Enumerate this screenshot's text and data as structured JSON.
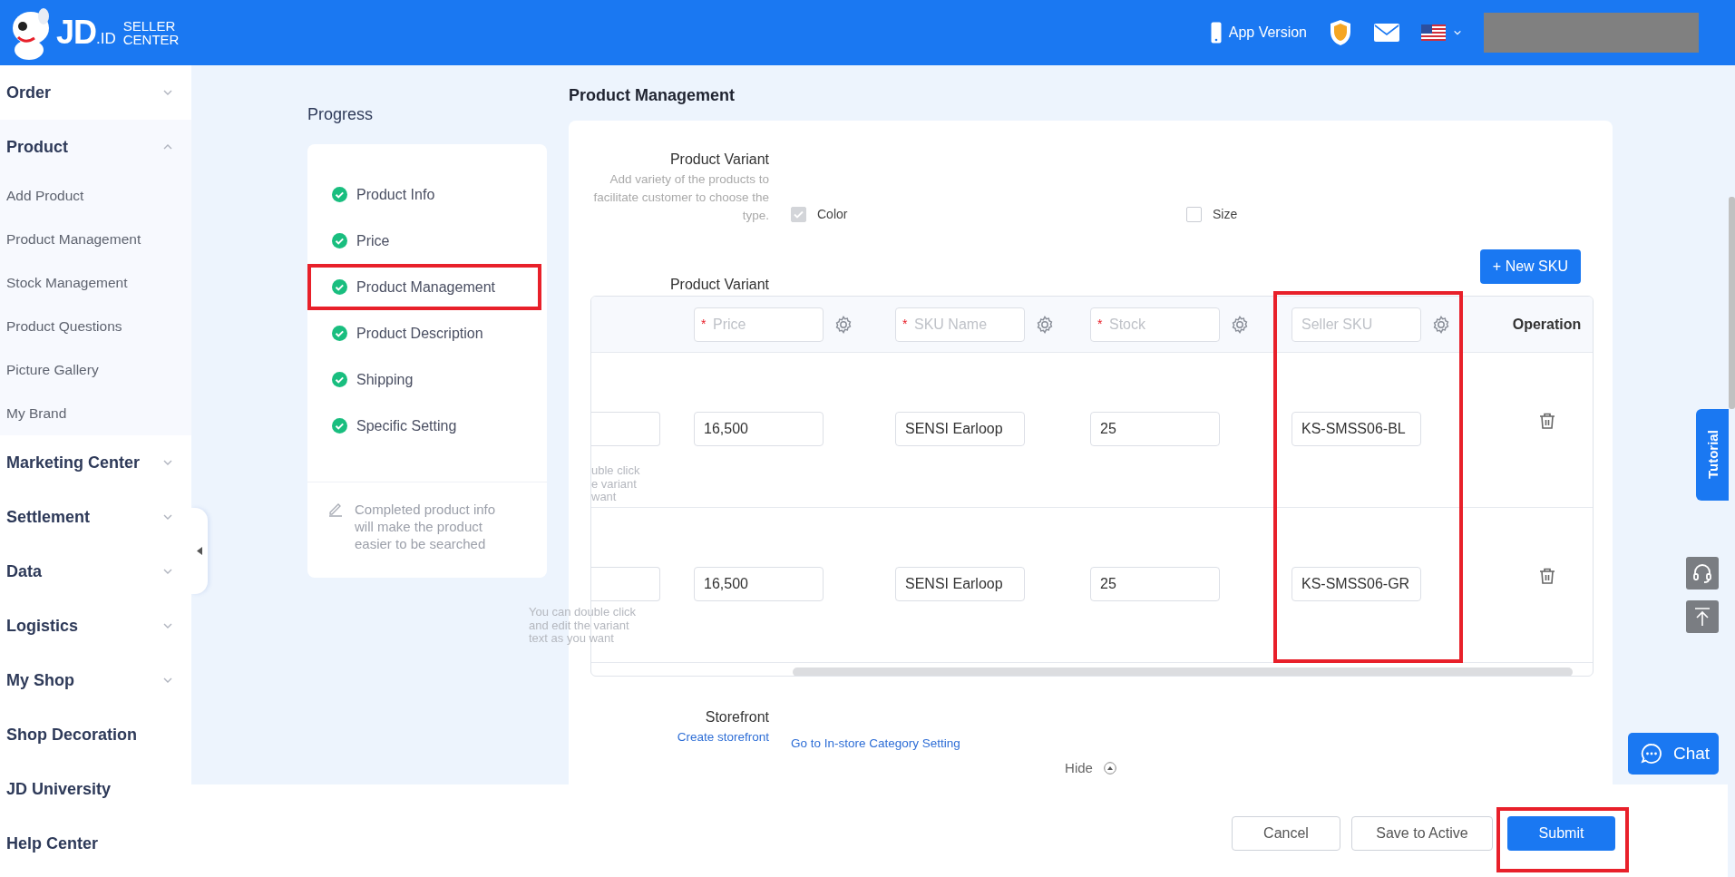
{
  "header": {
    "wordmark": "JD",
    "wordmark_suffix": ".ID",
    "subtitle": "SELLER CENTER",
    "app_version": "App Version"
  },
  "sidebar": {
    "items": [
      {
        "label": "Order",
        "kind": "group",
        "expanded": false
      },
      {
        "label": "Product",
        "kind": "group",
        "expanded": true,
        "children": [
          {
            "label": "Add Product"
          },
          {
            "label": "Product Management"
          },
          {
            "label": "Stock Management"
          },
          {
            "label": "Product Questions"
          },
          {
            "label": "Picture Gallery"
          },
          {
            "label": "My Brand"
          }
        ]
      },
      {
        "label": "Marketing Center",
        "kind": "group",
        "expanded": false
      },
      {
        "label": "Settlement",
        "kind": "group",
        "expanded": false
      },
      {
        "label": "Data",
        "kind": "group",
        "expanded": false
      },
      {
        "label": "Logistics",
        "kind": "group",
        "expanded": false
      },
      {
        "label": "My Shop",
        "kind": "group",
        "expanded": false
      },
      {
        "label": "Shop Decoration",
        "kind": "link"
      },
      {
        "label": "JD University",
        "kind": "link"
      },
      {
        "label": "Help Center",
        "kind": "link"
      }
    ]
  },
  "progress": {
    "title": "Progress",
    "steps": [
      {
        "label": "Product Info",
        "done": true,
        "highlighted": false
      },
      {
        "label": "Price",
        "done": true,
        "highlighted": false
      },
      {
        "label": "Product Management",
        "done": true,
        "highlighted": true
      },
      {
        "label": "Product Description",
        "done": true,
        "highlighted": false
      },
      {
        "label": "Shipping",
        "done": true,
        "highlighted": false
      },
      {
        "label": "Specific Setting",
        "done": true,
        "highlighted": false
      }
    ],
    "note": "Completed product info will make the product easier to be searched"
  },
  "content": {
    "title": "Product Management",
    "variant_types": {
      "label": "Product Variant",
      "description": "Add variety of the products to facilitate customer to choose the type.",
      "options": [
        {
          "label": "Color",
          "checked": true,
          "disabled": true
        },
        {
          "label": "Size",
          "checked": false,
          "disabled": false
        }
      ]
    },
    "sku_table": {
      "label": "Product Variant",
      "new_button": "+ New SKU",
      "columns": [
        {
          "kind": "clipped"
        },
        {
          "kind": "field",
          "mark": "*",
          "placeholder": "Price",
          "highlighted": false
        },
        {
          "kind": "field",
          "mark": "*",
          "placeholder": "SKU Name",
          "highlighted": false
        },
        {
          "kind": "field",
          "mark": "*",
          "placeholder": "Stock",
          "highlighted": false
        },
        {
          "kind": "field",
          "placeholder": "Seller SKU",
          "highlighted": true
        },
        {
          "kind": "text",
          "label": "Operation"
        }
      ],
      "rows": [
        {
          "kind": "hint_clipped",
          "hint_lines": [
            "uble click",
            "e variant",
            "want"
          ],
          "price": "16,500",
          "sku_name": "SENSI Earloop",
          "stock": "25",
          "seller_sku": "KS-SMSS06-BL"
        },
        {
          "kind": "hint_overflow",
          "hint_lines": [
            "You can double click",
            "and edit the variant",
            "text as you want"
          ],
          "price": "16,500",
          "sku_name": "SENSI Earloop",
          "stock": "25",
          "seller_sku": "KS-SMSS06-GR"
        }
      ]
    },
    "storefront": {
      "label": "Storefront",
      "create_link": "Create storefront",
      "category_link": "Go to In-store Category Setting"
    },
    "hide_toggle": "Hide"
  },
  "footer": {
    "buttons": [
      {
        "label": "Cancel",
        "kind": "default",
        "highlighted": false
      },
      {
        "label": "Save to Active",
        "kind": "default",
        "highlighted": false
      },
      {
        "label": "Submit",
        "kind": "primary",
        "highlighted": true
      }
    ]
  },
  "floating": {
    "tutorial": "Tutorial",
    "chat": "Chat"
  }
}
